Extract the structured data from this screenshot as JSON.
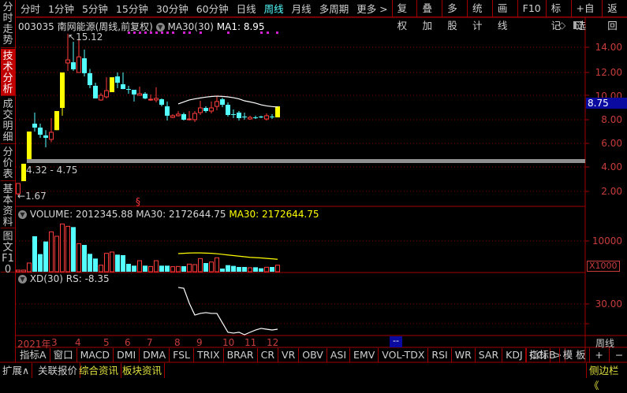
{
  "sidebar": [
    "分时走势",
    "技术分析",
    "成交明细",
    "分价表",
    "基本资料",
    "图文F10"
  ],
  "toolbar": {
    "periods": [
      "分时",
      "1分钟",
      "5分钟",
      "15分钟",
      "30分钟",
      "60分钟",
      "日线",
      "周线",
      "月线",
      "多周期",
      "更多 >"
    ],
    "active_period": "周线",
    "buttons": [
      "复权",
      "叠加",
      "多股",
      "统计",
      "画线",
      "F10",
      "标记",
      "+自选",
      "返回"
    ]
  },
  "main": {
    "title": "003035 南网能源(周线,前复权)",
    "ma_label": "MA30(30)",
    "ma_value": "MA1: 8.95",
    "high_label": "15.12",
    "low_label": "1.67",
    "range_label": "4.32 - 4.75",
    "event_mark": "§",
    "current_price": "8.75",
    "axis": [
      "14.00",
      "12.00",
      "10.00",
      "8.00",
      "6.00",
      "4.00",
      "2.00"
    ]
  },
  "volume": {
    "label": "VOLUME: 2012345.88",
    "ma_white": "MA30: 2172644.75",
    "ma_yellow": "MA30: 2172644.75",
    "axis": "10000",
    "unit": "X1000"
  },
  "xd": {
    "label": "XD(30)",
    "rs": "RS: -8.35",
    "axis": "30.00"
  },
  "time_axis": {
    "months": [
      "2021年",
      "3",
      "4",
      "5",
      "6",
      "7",
      "8",
      "9",
      "10",
      "11",
      "12"
    ],
    "cursor": "--",
    "period": "周线"
  },
  "indicator_tabs": [
    "指标A",
    "窗口",
    "MACD",
    "DMI",
    "DMA",
    "FSL",
    "TRIX",
    "BRAR",
    "CR",
    "VR",
    "OBV",
    "ASI",
    "EMV",
    "VOL-TDX",
    "RSI",
    "WR",
    "SAR",
    "KDJ",
    "CCI",
    ">"
  ],
  "indicator_right": [
    "指标B",
    "模 板",
    "+",
    "−"
  ],
  "bottom": {
    "expand": "扩展∧",
    "related": "关联报价",
    "news": "综合资讯",
    "sector": "板块资讯",
    "sidebar_toggle": "侧边栏《"
  },
  "colors": {
    "up": "#ff3c3c",
    "down": "#54ffff",
    "limit": "#ffff00",
    "grid": "#800000",
    "axis_text": "#c83c3c",
    "ma": "#ffffff",
    "vol_ma": "#ffff00"
  },
  "chart_data": {
    "type": "candlestick",
    "price_range": [
      1,
      16
    ],
    "candles": [
      [
        1.8,
        2.66,
        1.67,
        2.66,
        "up"
      ],
      [
        2.85,
        4.3,
        2.85,
        4.3,
        "limit"
      ],
      [
        4.69,
        6.98,
        4.69,
        6.98,
        "limit"
      ],
      [
        7.64,
        8.56,
        6.98,
        7.31,
        "down"
      ],
      [
        7.31,
        7.64,
        6.46,
        6.72,
        "down"
      ],
      [
        6.66,
        7.1,
        5.67,
        6.46,
        "down"
      ],
      [
        6.33,
        8.1,
        6.1,
        6.92,
        "up"
      ],
      [
        7.1,
        8.69,
        7.1,
        8.69,
        "limit"
      ],
      [
        8.95,
        11.9,
        8.3,
        11.9,
        "limit"
      ],
      [
        12.69,
        15.12,
        12.03,
        12.95,
        "up"
      ],
      [
        12.75,
        14.46,
        12.03,
        12.16,
        "down"
      ],
      [
        11.9,
        15.0,
        11.9,
        13.2,
        "up"
      ],
      [
        13.08,
        13.8,
        11.57,
        11.84,
        "down"
      ],
      [
        11.84,
        12.2,
        10.6,
        10.85,
        "down"
      ],
      [
        10.79,
        11.05,
        9.74,
        9.74,
        "down"
      ],
      [
        9.61,
        10.2,
        9.54,
        10.0,
        "up"
      ],
      [
        9.87,
        11.5,
        9.74,
        10.39,
        "up"
      ],
      [
        10.26,
        11.5,
        10.26,
        11.5,
        "limit"
      ],
      [
        11.57,
        11.9,
        10.6,
        11.05,
        "down"
      ],
      [
        10.92,
        11.9,
        10.52,
        10.52,
        "down"
      ],
      [
        10.52,
        10.79,
        10.13,
        10.52,
        "down"
      ],
      [
        10.46,
        10.46,
        9.48,
        10.07,
        "down"
      ],
      [
        10.0,
        10.72,
        10.0,
        10.13,
        "up"
      ],
      [
        10.13,
        10.26,
        9.67,
        9.74,
        "down"
      ],
      [
        9.67,
        10.07,
        9.54,
        9.67,
        "up"
      ],
      [
        9.61,
        10.66,
        9.41,
        9.74,
        "up"
      ],
      [
        9.67,
        9.74,
        9.08,
        9.21,
        "down"
      ],
      [
        9.08,
        9.48,
        7.9,
        8.3,
        "down"
      ],
      [
        8.16,
        8.43,
        8.1,
        8.3,
        "up"
      ],
      [
        8.3,
        8.69,
        8.23,
        8.43,
        "up"
      ],
      [
        8.43,
        8.56,
        7.9,
        7.97,
        "down"
      ],
      [
        7.97,
        8.69,
        7.9,
        8.03,
        "up"
      ],
      [
        7.97,
        8.69,
        7.77,
        8.49,
        "up"
      ],
      [
        8.56,
        9.54,
        8.36,
        8.95,
        "up"
      ],
      [
        8.95,
        9.08,
        8.56,
        8.69,
        "down"
      ],
      [
        8.69,
        9.48,
        8.49,
        8.95,
        "up"
      ],
      [
        9.08,
        9.93,
        8.76,
        9.48,
        "up"
      ],
      [
        9.67,
        9.8,
        9.01,
        9.21,
        "down"
      ],
      [
        9.21,
        9.41,
        8.23,
        8.36,
        "down"
      ],
      [
        8.43,
        8.82,
        8.1,
        8.43,
        "down"
      ],
      [
        8.56,
        8.69,
        7.9,
        8.1,
        "down"
      ],
      [
        8.23,
        8.56,
        7.97,
        8.16,
        "down"
      ],
      [
        8.03,
        8.3,
        7.97,
        8.16,
        "up"
      ],
      [
        8.16,
        8.3,
        8.03,
        8.16,
        "down"
      ],
      [
        8.23,
        8.3,
        8.1,
        8.16,
        "down"
      ],
      [
        8.03,
        8.49,
        7.9,
        8.3,
        "up"
      ],
      [
        8.23,
        8.43,
        8.03,
        8.23,
        "down"
      ],
      [
        8.16,
        9.08,
        8.16,
        9.08,
        "limit"
      ]
    ],
    "ma30": {
      "start_index": 29,
      "values": [
        9.28,
        9.45,
        9.61,
        9.7,
        9.78,
        9.85,
        9.9,
        9.93,
        9.91,
        9.87,
        9.8,
        9.7,
        9.54,
        9.45,
        9.35,
        9.21,
        9.12,
        9.06,
        9.02
      ]
    },
    "volume_thousands": [
      530,
      530,
      2900,
      11840,
      5880,
      10090,
      13330,
      11840,
      15960,
      15170,
      14910,
      9380,
      8950,
      5960,
      4390,
      2190,
      6140,
      6580,
      5700,
      5530,
      2630,
      2020,
      3680,
      2020,
      1750,
      3680,
      2020,
      2020,
      1670,
      1750,
      1840,
      2540,
      2370,
      4390,
      2890,
      3240,
      4650,
      1050,
      2190,
      1930,
      1580,
      1580,
      1320,
      1490,
      1140,
      1490,
      1580,
      2190
    ],
    "volume_ma30": {
      "start_index": 29,
      "values": [
        6050,
        6150,
        6250,
        6300,
        6280,
        6220,
        6150,
        6000,
        5800,
        5600,
        5400,
        5200,
        5000,
        4800,
        4700,
        4600,
        4450,
        4300,
        4150
      ]
    },
    "xd": {
      "start_index": 29,
      "values": [
        38.1,
        37.7,
        30.4,
        24.6,
        25.4,
        25.8,
        25.4,
        25.4,
        20.8,
        16.2,
        15.8,
        16.2,
        15.0,
        16.2,
        17.3,
        18.1,
        17.7,
        17.3,
        17.7
      ]
    }
  }
}
